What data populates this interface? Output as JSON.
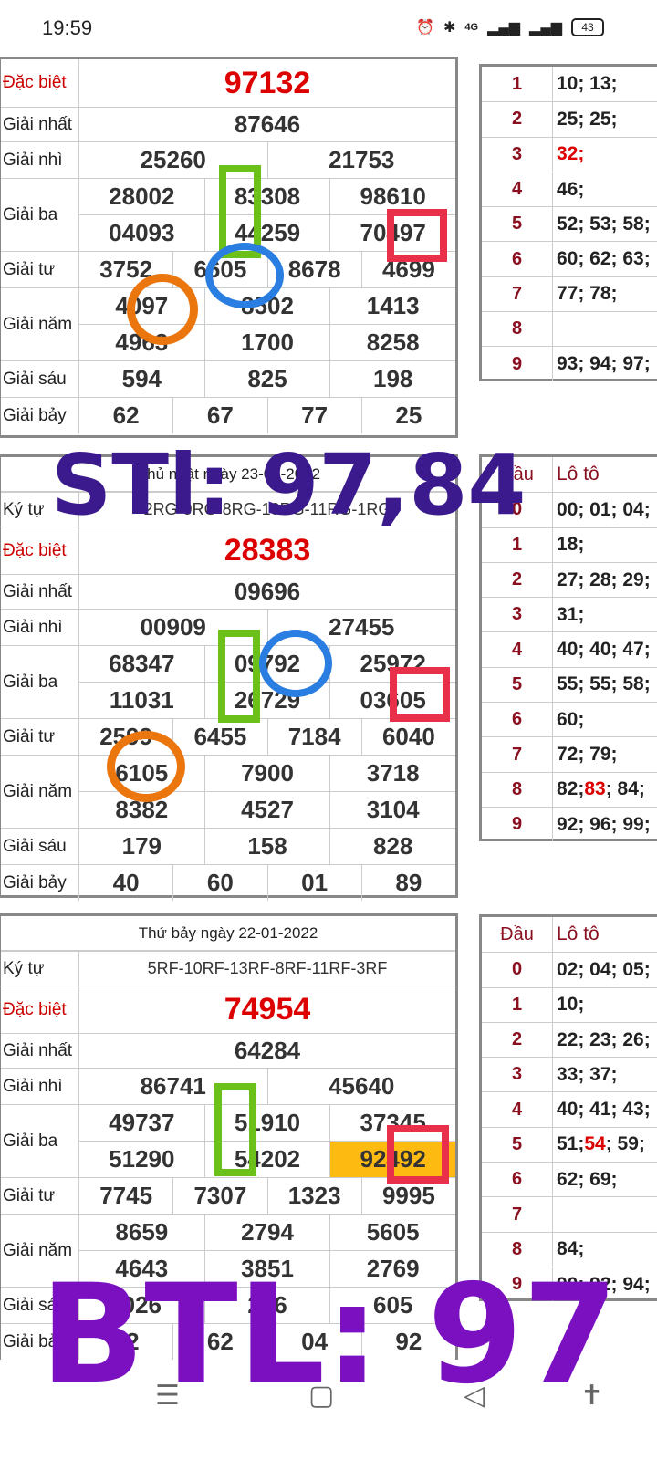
{
  "status_bar": {
    "time": "19:59",
    "net": "4G",
    "battery": "43"
  },
  "labels": {
    "db": "Đặc biệt",
    "g1": "Giải nhất",
    "g2": "Giải nhì",
    "g3": "Giải ba",
    "g4": "Giải tư",
    "g5": "Giải năm",
    "g6": "Giải sáu",
    "g7": "Giải bảy",
    "kytu": "Ký tự"
  },
  "lt_header": {
    "dau": "Đầu",
    "loto": "Lô tô"
  },
  "block1": {
    "db": "97132",
    "g1": "87646",
    "g2": [
      "25260",
      "21753"
    ],
    "g3a": [
      "28002",
      "83308",
      "98610"
    ],
    "g3b": [
      "04093",
      "44259",
      "70497"
    ],
    "g4": [
      "3752",
      "6605",
      "8678",
      "4699"
    ],
    "g5a": [
      "4097",
      "8502",
      "1413"
    ],
    "g5b": [
      "4963",
      "1700",
      "8258"
    ],
    "g6": [
      "594",
      "825",
      "198"
    ],
    "g7": [
      "62",
      "67",
      "77",
      "25"
    ]
  },
  "lt1": [
    {
      "d": "1",
      "v": "10; 13;"
    },
    {
      "d": "2",
      "v": "25; 25;"
    },
    {
      "d": "3",
      "v": "32;",
      "red": true
    },
    {
      "d": "4",
      "v": "46;"
    },
    {
      "d": "5",
      "v": "52; 53; 58;"
    },
    {
      "d": "6",
      "v": "60; 62; 63;"
    },
    {
      "d": "7",
      "v": "77; 78;"
    },
    {
      "d": "8",
      "v": ""
    },
    {
      "d": "9",
      "v": "93; 94; 97;"
    }
  ],
  "block2": {
    "date": "Chủ nhật ngày 23-01-2022",
    "kytu": "2RG-9RG-8RG-10RG-11RG-1RG",
    "db": "28383",
    "g1": "09696",
    "g2": [
      "00909",
      "27455"
    ],
    "g3a": [
      "68347",
      "09792",
      "25972"
    ],
    "g3b": [
      "11031",
      "26729",
      "03605"
    ],
    "g4": [
      "2599",
      "6455",
      "7184",
      "6040"
    ],
    "g5a": [
      "6105",
      "7900",
      "3718"
    ],
    "g5b": [
      "8382",
      "4527",
      "3104"
    ],
    "g6": [
      "179",
      "158",
      "828"
    ],
    "g7": [
      "40",
      "60",
      "01",
      "89"
    ]
  },
  "lt2": [
    {
      "d": "0",
      "v": "00; 01; 04;"
    },
    {
      "d": "1",
      "v": "18;"
    },
    {
      "d": "2",
      "v": "27; 28; 29;"
    },
    {
      "d": "3",
      "v": "31;"
    },
    {
      "d": "4",
      "v": "40; 40; 47;"
    },
    {
      "d": "5",
      "v": "55; 55; 58;"
    },
    {
      "d": "6",
      "v": "60;"
    },
    {
      "d": "7",
      "v": "72; 79;"
    },
    {
      "d": "8",
      "pre": "82; ",
      "red": "83",
      "post": "; 84;"
    },
    {
      "d": "9",
      "v": "92; 96; 99;"
    }
  ],
  "block3": {
    "date": "Thứ bảy ngày 22-01-2022",
    "kytu": "5RF-10RF-13RF-8RF-11RF-3RF",
    "db": "74954",
    "g1": "64284",
    "g2": [
      "86741",
      "45640"
    ],
    "g3a": [
      "49737",
      "51910",
      "37345"
    ],
    "g3b": [
      "51290",
      "54202",
      "92492"
    ],
    "g4": [
      "7745",
      "7307",
      "1323",
      "9995"
    ],
    "g5a": [
      "8659",
      "2794",
      "5605"
    ],
    "g5b": [
      "4643",
      "3851",
      "2769"
    ],
    "g6": [
      "026",
      "226",
      "605"
    ],
    "g7": [
      "22",
      "62",
      "04",
      "92"
    ]
  },
  "lt3": [
    {
      "d": "0",
      "v": "02; 04; 05;"
    },
    {
      "d": "1",
      "v": "10;"
    },
    {
      "d": "2",
      "v": "22; 23; 26;"
    },
    {
      "d": "3",
      "v": "33; 37;"
    },
    {
      "d": "4",
      "v": "40; 41; 43;"
    },
    {
      "d": "5",
      "pre": "51; ",
      "red": "54",
      "post": "; 59;"
    },
    {
      "d": "6",
      "v": "62; 69;"
    },
    {
      "d": "7",
      "v": ""
    },
    {
      "d": "8",
      "v": "84;"
    },
    {
      "d": "9",
      "v": "90; 92; 94;"
    }
  ],
  "overlays": {
    "stl": "STl: 97,84",
    "btl": "BTL: 97"
  },
  "colors": {
    "red": "#dd0000",
    "overlay_navy": "#3a1a8c",
    "overlay_purple": "#7a10c0",
    "green": "#6cc01a",
    "blue": "#2a7de1",
    "orange": "#ec760e",
    "crimson": "#e8304a",
    "highlight": "#fdbb12"
  }
}
